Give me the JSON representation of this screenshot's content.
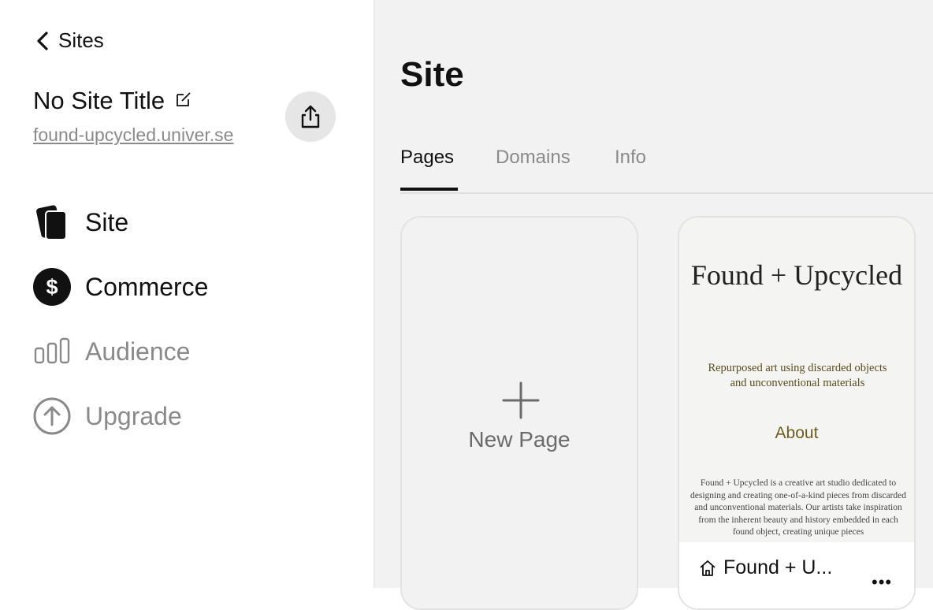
{
  "sidebar": {
    "back_label": "Sites",
    "site_title": "No Site Title",
    "site_url": "found-upcycled.univer.se",
    "nav": [
      {
        "label": "Site",
        "icon": "pages-icon"
      },
      {
        "label": "Commerce",
        "icon": "dollar-icon"
      },
      {
        "label": "Audience",
        "icon": "bar-chart-icon"
      },
      {
        "label": "Upgrade",
        "icon": "arrow-up-circle-icon"
      }
    ]
  },
  "main": {
    "heading": "Site",
    "tabs": [
      {
        "label": "Pages",
        "active": true
      },
      {
        "label": "Domains",
        "active": false
      },
      {
        "label": "Info",
        "active": false
      }
    ],
    "new_page_label": "New Page",
    "pages": [
      {
        "preview_title": "Found + Upcycled",
        "preview_subtitle": "Repurposed art using discarded objects and unconventional materials",
        "preview_about": "About",
        "preview_body": "Found + Upcycled is a creative art studio dedicated to designing and creating one-of-a-kind pieces from discarded and unconventional materials. Our artists take inspiration from the inherent beauty and history embedded in each found object, creating unique pieces",
        "name": "Found + U...",
        "more_label": "•••"
      }
    ]
  },
  "colors": {
    "sidebar_bg": "#ffffff",
    "main_bg": "#f2f2f2",
    "muted_text": "#8a8a8a",
    "accent_text": "#111111",
    "preview_gold": "#6e5c1e"
  }
}
